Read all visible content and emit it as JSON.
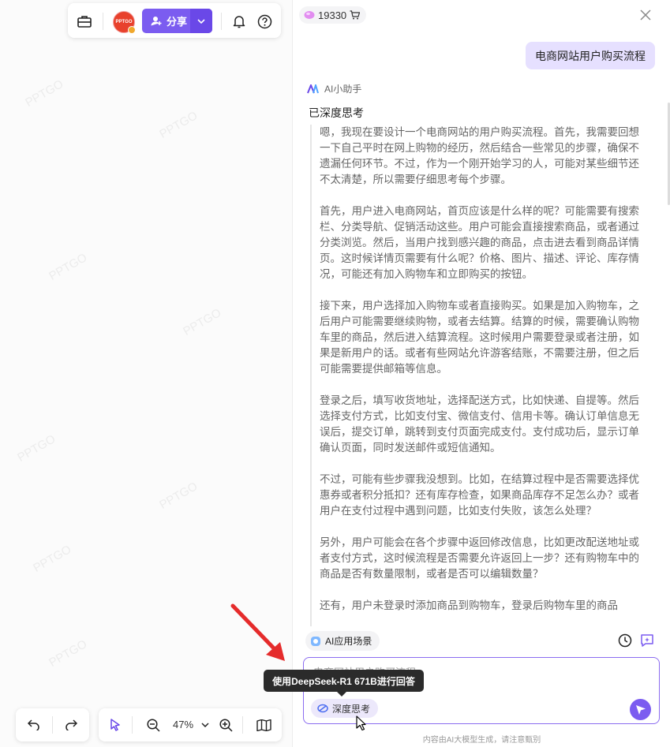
{
  "watermark": {
    "text": "PPTGO"
  },
  "toolbar": {
    "avatar_text": "PPTGO",
    "share_label": "分享"
  },
  "bottom_toolbar": {
    "zoom": "47%"
  },
  "panel": {
    "credits": "19330",
    "user_message": "电商网站用户购买流程",
    "assistant_name": "AI小助手",
    "thinking_title": "已深度思考",
    "thinking_paragraphs": [
      "嗯，我现在要设计一个电商网站的用户购买流程。首先，我需要回想一下自己平时在网上购物的经历，然后结合一些常见的步骤，确保不遗漏任何环节。不过，作为一个刚开始学习的人，可能对某些细节还不太清楚，所以需要仔细思考每个步骤。",
      "首先，用户进入电商网站，首页应该是什么样的呢？可能需要有搜索栏、分类导航、促销活动这些。用户可能会直接搜索商品，或者通过分类浏览。然后，当用户找到感兴趣的商品，点击进去看到商品详情页。这时候详情页需要有什么呢？价格、图片、描述、评论、库存情况，可能还有加入购物车和立即购买的按钮。",
      "接下来，用户选择加入购物车或者直接购买。如果是加入购物车，之后用户可能需要继续购物，或者去结算。结算的时候，需要确认购物车里的商品，然后进入结算流程。这时候用户需要登录或者注册，如果是新用户的话。或者有些网站允许游客结账，不需要注册，但之后可能需要提供邮箱等信息。",
      "登录之后，填写收货地址，选择配送方式，比如快递、自提等。然后选择支付方式，比如支付宝、微信支付、信用卡等。确认订单信息无误后，提交订单，跳转到支付页面完成支付。支付成功后，显示订单确认页面，同时发送邮件或短信通知。",
      "不过，可能有些步骤我没想到。比如，在结算过程中是否需要选择优惠券或者积分抵扣？还有库存检查，如果商品库存不足怎么办？或者用户在支付过程中遇到问题，比如支付失败，该怎么处理？",
      "另外，用户可能会在各个步骤中返回修改信息，比如更改配送地址或者支付方式，这时候流程是否需要允许返回上一步？还有购物车中的商品是否有数量限制，或者是否可以编辑数量？",
      "还有，用户未登录时添加商品到购物车，登录后购物车里的商品"
    ],
    "scene_label": "AI应用场景",
    "input_ghost": "电商网站用户购买流程",
    "deep_think_label": "深度思考",
    "tooltip": "使用DeepSeek-R1 671B进行回答",
    "disclaimer": "内容由AI大模型生成，请注意甄别"
  },
  "colors": {
    "accent": "#7b5cf0",
    "user_bubble": "#e6e0ff",
    "annotation_arrow": "#e52b2b"
  }
}
